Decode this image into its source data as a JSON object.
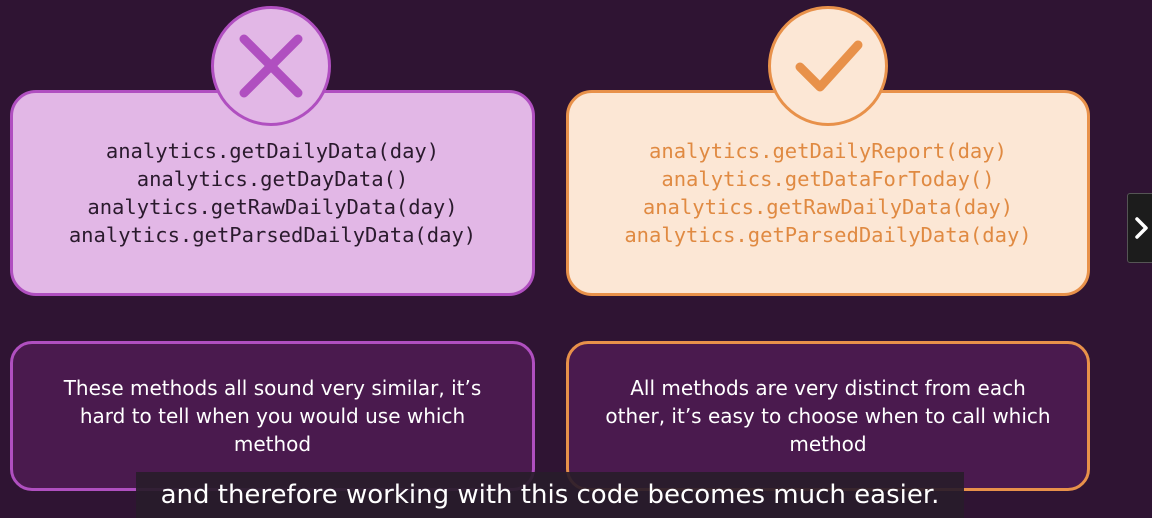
{
  "bad_example": {
    "code_lines": [
      "analytics.getDailyData(day)",
      "analytics.getDayData()",
      "analytics.getRawDailyData(day)",
      "analytics.getParsedDailyData(day)"
    ],
    "description": "These methods all sound very similar, it’s hard to tell when you would use which method",
    "icon": "x-mark-icon"
  },
  "good_example": {
    "code_lines": [
      "analytics.getDailyReport(day)",
      "analytics.getDataForToday()",
      "analytics.getRawDailyData(day)",
      "analytics.getParsedDailyData(day)"
    ],
    "description": "All methods are very distinct from each other, it’s easy to choose when to call which method",
    "icon": "checkmark-icon"
  },
  "subtitle": "and therefore working with this code becomes much easier.",
  "next_button": {
    "icon": "chevron-right-icon"
  },
  "colors": {
    "background": "#2f1433",
    "bad_accent": "#b04fc0",
    "bad_fill": "#e2b7e6",
    "good_accent": "#e8914a",
    "good_fill": "#fce7d5",
    "desc_fill": "#4a1a4e"
  }
}
